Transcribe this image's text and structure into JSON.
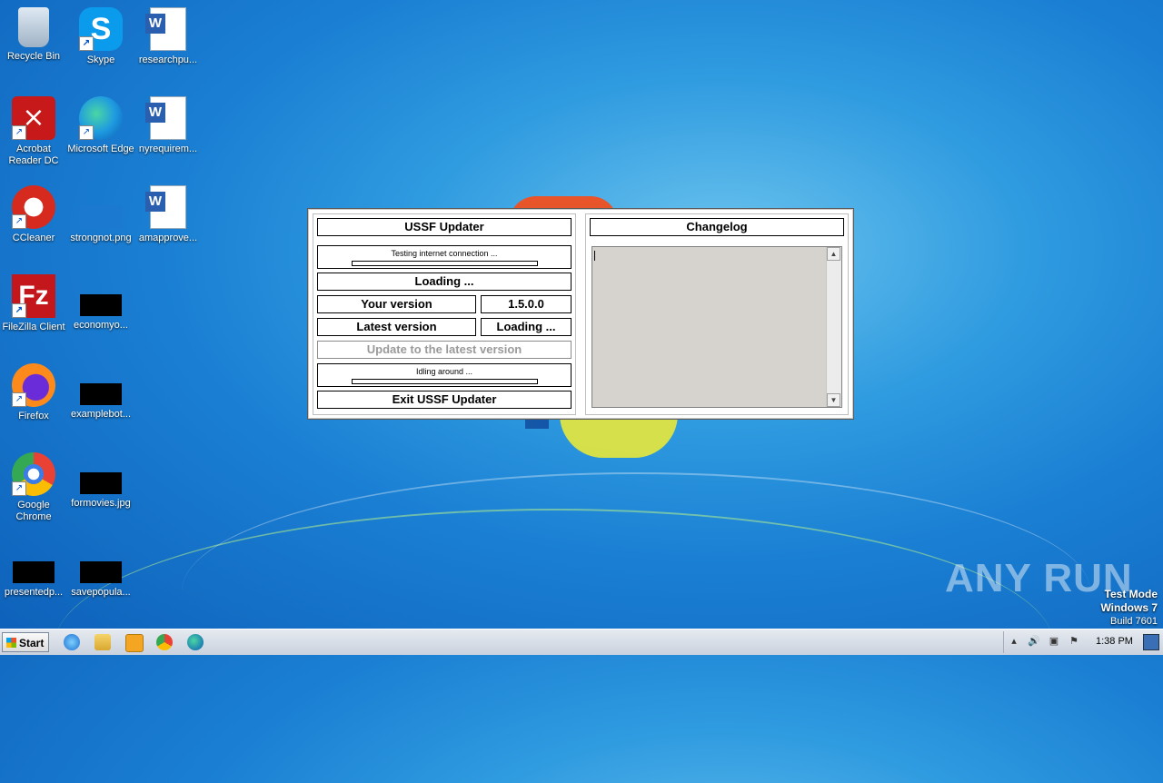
{
  "desktop": {
    "icons": [
      {
        "label": "Recycle Bin"
      },
      {
        "label": "Skype"
      },
      {
        "label": "researchpu..."
      },
      {
        "label": "Acrobat Reader DC"
      },
      {
        "label": "Microsoft Edge"
      },
      {
        "label": "nyrequirem..."
      },
      {
        "label": "CCleaner"
      },
      {
        "label": "strongnot.png"
      },
      {
        "label": "amapprove..."
      },
      {
        "label": "FileZilla Client"
      },
      {
        "label": "economyo..."
      },
      {
        "label": "Firefox"
      },
      {
        "label": "examplebot..."
      },
      {
        "label": "Google Chrome"
      },
      {
        "label": "formovies.jpg"
      },
      {
        "label": "presentedp..."
      },
      {
        "label": "savepopula..."
      }
    ]
  },
  "updater": {
    "title": "USSF Updater",
    "connection_status": "Testing internet connection ...",
    "loading_label": "Loading ...",
    "your_version_label": "Your version",
    "your_version_value": "1.5.0.0",
    "latest_version_label": "Latest version",
    "latest_version_value": "Loading ...",
    "update_button": "Update to the latest version",
    "idle_status": "Idling around ...",
    "exit_button": "Exit USSF Updater",
    "changelog_title": "Changelog",
    "changelog_text": ""
  },
  "watermark": {
    "text": "ANY RUN"
  },
  "test_mode": {
    "line1": "Test Mode",
    "line2": "Windows 7",
    "line3": "Build 7601"
  },
  "taskbar": {
    "start_label": "Start",
    "clock": "1:38 PM"
  }
}
